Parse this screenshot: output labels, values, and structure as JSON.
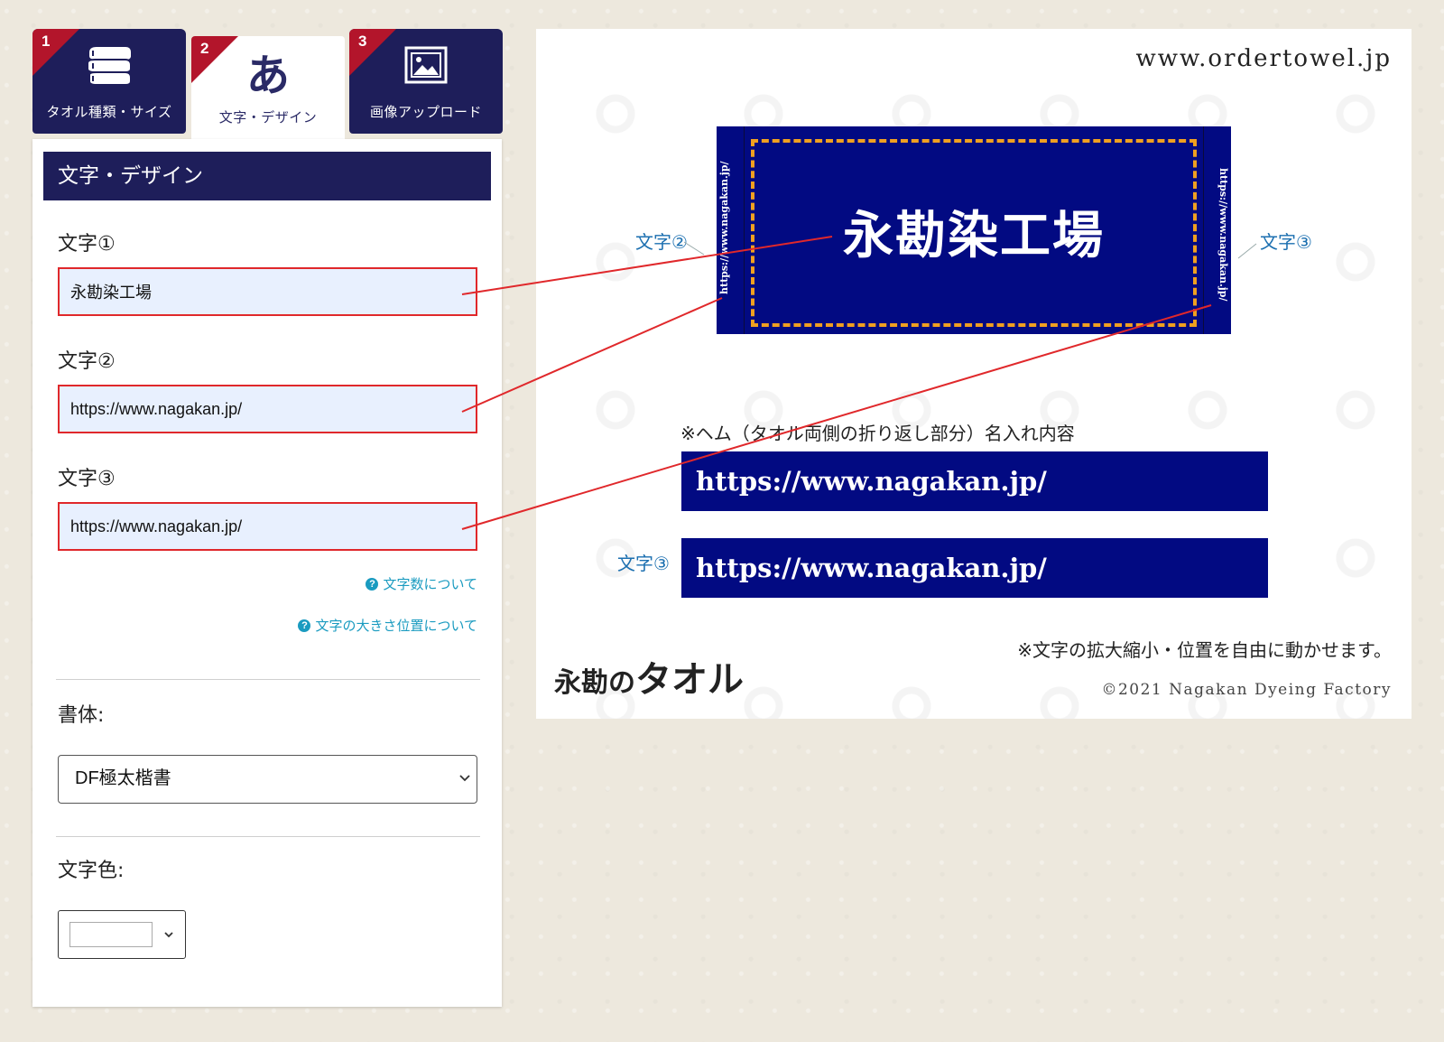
{
  "tabs": [
    {
      "num": "1",
      "label": "タオル種類・サイズ",
      "icon": "towel-stack-icon"
    },
    {
      "num": "2",
      "label": "文字・デザイン",
      "glyph": "あ"
    },
    {
      "num": "3",
      "label": "画像アップロード",
      "icon": "image-icon"
    }
  ],
  "panel": {
    "header": "文字・デザイン",
    "fields": [
      {
        "label": "文字①",
        "value": "永勘染工場"
      },
      {
        "label": "文字②",
        "value": "https://www.nagakan.jp/"
      },
      {
        "label": "文字③",
        "value": "https://www.nagakan.jp/"
      }
    ],
    "help_links": [
      "文字数について",
      "文字の大きさ位置について"
    ],
    "help_glyph": "?",
    "font_label": "書体:",
    "font_value": "DF極太楷書",
    "color_label": "文字色:",
    "color_value": "#ffffff"
  },
  "preview": {
    "domain": "www.ordertowel.jp",
    "towel_main": "永勘染工場",
    "towel_left_hem": "https://www.nagakan.jp/",
    "towel_right_hem": "https://www.nagakan.jp/",
    "side_label_2": "文字②",
    "side_label_3": "文字③",
    "hem_note": "※ヘム（タオル両側の折り返し部分）名入れ内容",
    "hem_bar_1": "https://www.nagakan.jp/",
    "hem_bar_3_label": "文字③",
    "hem_bar_2": "https://www.nagakan.jp/",
    "caption": "※文字の拡大縮小・位置を自由に動かせます。",
    "logo_a": "永勘の",
    "logo_b": "タオル",
    "copyright": "©2021 Nagakan Dyeing Factory"
  },
  "colors": {
    "navy": "#1e1e5a",
    "towel_blue": "#020a82",
    "tab_flag_red": "#b3152b",
    "input_border_red": "#e0282b",
    "input_bg": "#e8f0fe",
    "help_link": "#1a9bc0",
    "dash_orange": "#f0a020",
    "side_label_blue": "#1b6fb0"
  }
}
